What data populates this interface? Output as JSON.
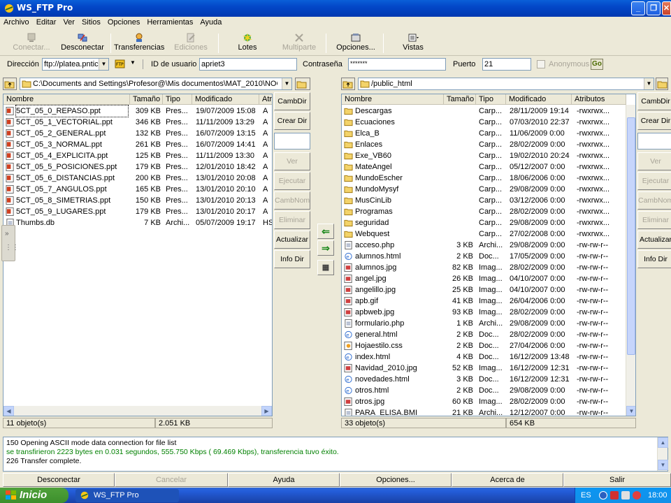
{
  "window": {
    "title": "WS_FTP Pro"
  },
  "menu": [
    "Archivo",
    "Editar",
    "Ver",
    "Sitios",
    "Opciones",
    "Herramientas",
    "Ayuda"
  ],
  "toolbar": {
    "conectar": "Conectar...",
    "desconectar": "Desconectar",
    "transferencias": "Transferencias",
    "ediciones": "Ediciones",
    "lotes": "Lotes",
    "multiparte": "Multiparte",
    "opciones": "Opciones...",
    "vistas": "Vistas"
  },
  "address": {
    "direccion_label": "Dirección",
    "direccion_value": "ftp://platea.pntic",
    "id_label": "ID de usuario",
    "id_value": "apriet3",
    "pass_label": "Contraseña",
    "pass_value": "*******",
    "port_label": "Puerto",
    "port_value": "21",
    "anon_label": "Anonymous",
    "go_label": "Go"
  },
  "local": {
    "path": "C:\\Documents and Settings\\Profesor@\\Mis documentos\\MAT_2010\\NOCTU",
    "columns": [
      "Nombre",
      "Tamaño",
      "Tipo",
      "Modificado",
      "Atri"
    ],
    "files": [
      {
        "name": "5CT_05_0_REPASO.ppt",
        "size": "309 KB",
        "type": "Pres...",
        "mod": "19/07/2009 15:08",
        "attr": "A"
      },
      {
        "name": "5CT_05_1_VECTORIAL.ppt",
        "size": "346 KB",
        "type": "Pres...",
        "mod": "11/11/2009 13:29",
        "attr": "A"
      },
      {
        "name": "5CT_05_2_GENERAL.ppt",
        "size": "132 KB",
        "type": "Pres...",
        "mod": "16/07/2009 13:15",
        "attr": "A"
      },
      {
        "name": "5CT_05_3_NORMAL.ppt",
        "size": "261 KB",
        "type": "Pres...",
        "mod": "16/07/2009 14:41",
        "attr": "A"
      },
      {
        "name": "5CT_05_4_EXPLICITA.ppt",
        "size": "125 KB",
        "type": "Pres...",
        "mod": "11/11/2009 13:30",
        "attr": "A"
      },
      {
        "name": "5CT_05_5_POSICIONES.ppt",
        "size": "179 KB",
        "type": "Pres...",
        "mod": "12/01/2010 18:42",
        "attr": "A"
      },
      {
        "name": "5CT_05_6_DISTANCIAS.ppt",
        "size": "200 KB",
        "type": "Pres...",
        "mod": "13/01/2010 20:08",
        "attr": "A"
      },
      {
        "name": "5CT_05_7_ANGULOS.ppt",
        "size": "165 KB",
        "type": "Pres...",
        "mod": "13/01/2010 20:10",
        "attr": "A"
      },
      {
        "name": "5CT_05_8_SIMETRIAS.ppt",
        "size": "150 KB",
        "type": "Pres...",
        "mod": "13/01/2010 20:13",
        "attr": "A"
      },
      {
        "name": "5CT_05_9_LUGARES.ppt",
        "size": "179 KB",
        "type": "Pres...",
        "mod": "13/01/2010 20:17",
        "attr": "A"
      },
      {
        "name": "Thumbs.db",
        "size": "7 KB",
        "type": "Archi...",
        "mod": "05/07/2009 19:17",
        "attr": "HS"
      }
    ],
    "status_count": "11 objeto(s)",
    "status_size": "2.051 KB"
  },
  "remote": {
    "path": "/public_html",
    "columns": [
      "Nombre",
      "Tamaño",
      "Tipo",
      "Modificado",
      "Atributos"
    ],
    "files": [
      {
        "name": "Descargas",
        "size": "",
        "type": "Carp...",
        "mod": "28/11/2009 19:14",
        "attr": "-rwxrwx...",
        "kind": "folder"
      },
      {
        "name": "Ecuaciones",
        "size": "",
        "type": "Carp...",
        "mod": "07/03/2010 22:37",
        "attr": "-rwxrwx...",
        "kind": "folder"
      },
      {
        "name": "Elca_B",
        "size": "",
        "type": "Carp...",
        "mod": "11/06/2009 0:00",
        "attr": "-rwxrwx...",
        "kind": "folder"
      },
      {
        "name": "Enlaces",
        "size": "",
        "type": "Carp...",
        "mod": "28/02/2009 0:00",
        "attr": "-rwxrwx...",
        "kind": "folder"
      },
      {
        "name": "Exe_VB60",
        "size": "",
        "type": "Carp...",
        "mod": "19/02/2010 20:24",
        "attr": "-rwxrwx...",
        "kind": "folder"
      },
      {
        "name": "MateAngel",
        "size": "",
        "type": "Carp...",
        "mod": "05/12/2007 0:00",
        "attr": "-rwxrwx...",
        "kind": "folder"
      },
      {
        "name": "MundoEscher",
        "size": "",
        "type": "Carp...",
        "mod": "18/06/2006 0:00",
        "attr": "-rwxrwx...",
        "kind": "folder"
      },
      {
        "name": "MundoMysyf",
        "size": "",
        "type": "Carp...",
        "mod": "29/08/2009 0:00",
        "attr": "-rwxrwx...",
        "kind": "folder"
      },
      {
        "name": "MusCinLib",
        "size": "",
        "type": "Carp...",
        "mod": "03/12/2006 0:00",
        "attr": "-rwxrwx...",
        "kind": "folder"
      },
      {
        "name": "Programas",
        "size": "",
        "type": "Carp...",
        "mod": "28/02/2009 0:00",
        "attr": "-rwxrwx...",
        "kind": "folder"
      },
      {
        "name": "seguridad",
        "size": "",
        "type": "Carp...",
        "mod": "29/08/2009 0:00",
        "attr": "-rwxrwx...",
        "kind": "folder"
      },
      {
        "name": "Webquest",
        "size": "",
        "type": "Carp...",
        "mod": "27/02/2008 0:00",
        "attr": "-rwxrwx...",
        "kind": "folder"
      },
      {
        "name": "acceso.php",
        "size": "3 KB",
        "type": "Archi...",
        "mod": "29/08/2009 0:00",
        "attr": "-rw-rw-r--",
        "kind": "file"
      },
      {
        "name": "alumnos.html",
        "size": "2 KB",
        "type": "Doc...",
        "mod": "17/05/2009 0:00",
        "attr": "-rw-rw-r--",
        "kind": "html"
      },
      {
        "name": "alumnos.jpg",
        "size": "82 KB",
        "type": "Imag...",
        "mod": "28/02/2009 0:00",
        "attr": "-rw-rw-r--",
        "kind": "image"
      },
      {
        "name": "angel.jpg",
        "size": "26 KB",
        "type": "Imag...",
        "mod": "04/10/2007 0:00",
        "attr": "-rw-rw-r--",
        "kind": "image"
      },
      {
        "name": "angelillo.jpg",
        "size": "25 KB",
        "type": "Imag...",
        "mod": "04/10/2007 0:00",
        "attr": "-rw-rw-r--",
        "kind": "image"
      },
      {
        "name": "apb.gif",
        "size": "41 KB",
        "type": "Imag...",
        "mod": "26/04/2006 0:00",
        "attr": "-rw-rw-r--",
        "kind": "image"
      },
      {
        "name": "apbweb.jpg",
        "size": "93 KB",
        "type": "Imag...",
        "mod": "28/02/2009 0:00",
        "attr": "-rw-rw-r--",
        "kind": "image"
      },
      {
        "name": "formulario.php",
        "size": "1 KB",
        "type": "Archi...",
        "mod": "29/08/2009 0:00",
        "attr": "-rw-rw-r--",
        "kind": "file"
      },
      {
        "name": "general.html",
        "size": "2 KB",
        "type": "Doc...",
        "mod": "28/02/2009 0:00",
        "attr": "-rw-rw-r--",
        "kind": "html"
      },
      {
        "name": "Hojaestilo.css",
        "size": "2 KB",
        "type": "Doc...",
        "mod": "27/04/2006 0:00",
        "attr": "-rw-rw-r--",
        "kind": "css"
      },
      {
        "name": "index.html",
        "size": "4 KB",
        "type": "Doc...",
        "mod": "16/12/2009 13:48",
        "attr": "-rw-rw-r--",
        "kind": "html"
      },
      {
        "name": "Navidad_2010.jpg",
        "size": "52 KB",
        "type": "Imag...",
        "mod": "16/12/2009 12:31",
        "attr": "-rw-rw-r--",
        "kind": "image"
      },
      {
        "name": "novedades.html",
        "size": "3 KB",
        "type": "Doc...",
        "mod": "16/12/2009 12:31",
        "attr": "-rw-rw-r--",
        "kind": "html"
      },
      {
        "name": "otros.html",
        "size": "2 KB",
        "type": "Doc...",
        "mod": "29/08/2009 0:00",
        "attr": "-rw-rw-r--",
        "kind": "html"
      },
      {
        "name": "otros.jpg",
        "size": "60 KB",
        "type": "Imag...",
        "mod": "28/02/2009 0:00",
        "attr": "-rw-rw-r--",
        "kind": "image"
      },
      {
        "name": "PARA_ELISA.BMI",
        "size": "21 KB",
        "type": "Archi...",
        "mod": "12/12/2007 0:00",
        "attr": "-rw-rw-r--",
        "kind": "file"
      }
    ],
    "status_count": "33 objeto(s)",
    "status_size": "654 KB"
  },
  "side_buttons": {
    "cambdir": "CambDir",
    "creardir": "Crear Dir",
    "ver": "Ver",
    "ejecutar": "Ejecutar",
    "cambnom": "CambNom",
    "eliminar": "Eliminar",
    "actualizar": "Actualizar",
    "infodir": "Info Dir"
  },
  "log": [
    {
      "text": "150 Opening ASCII mode data connection for file list",
      "color": "#000000"
    },
    {
      "text": "se transfirieron 2223 bytes en 0.031 segundos, 555.750 Kbps  ( 69.469 Kbps), transferencia tuvo éxito.",
      "color": "#008000"
    },
    {
      "text": "226 Transfer complete.",
      "color": "#000000"
    }
  ],
  "bottom_buttons": {
    "desconectar": "Desconectar",
    "cancelar": "Cancelar",
    "ayuda": "Ayuda",
    "opciones": "Opciones...",
    "acerca": "Acerca de",
    "salir": "Salir"
  },
  "taskbar": {
    "start": "Inicio",
    "task": "WS_FTP Pro",
    "lang": "ES",
    "clock": "18:00"
  }
}
